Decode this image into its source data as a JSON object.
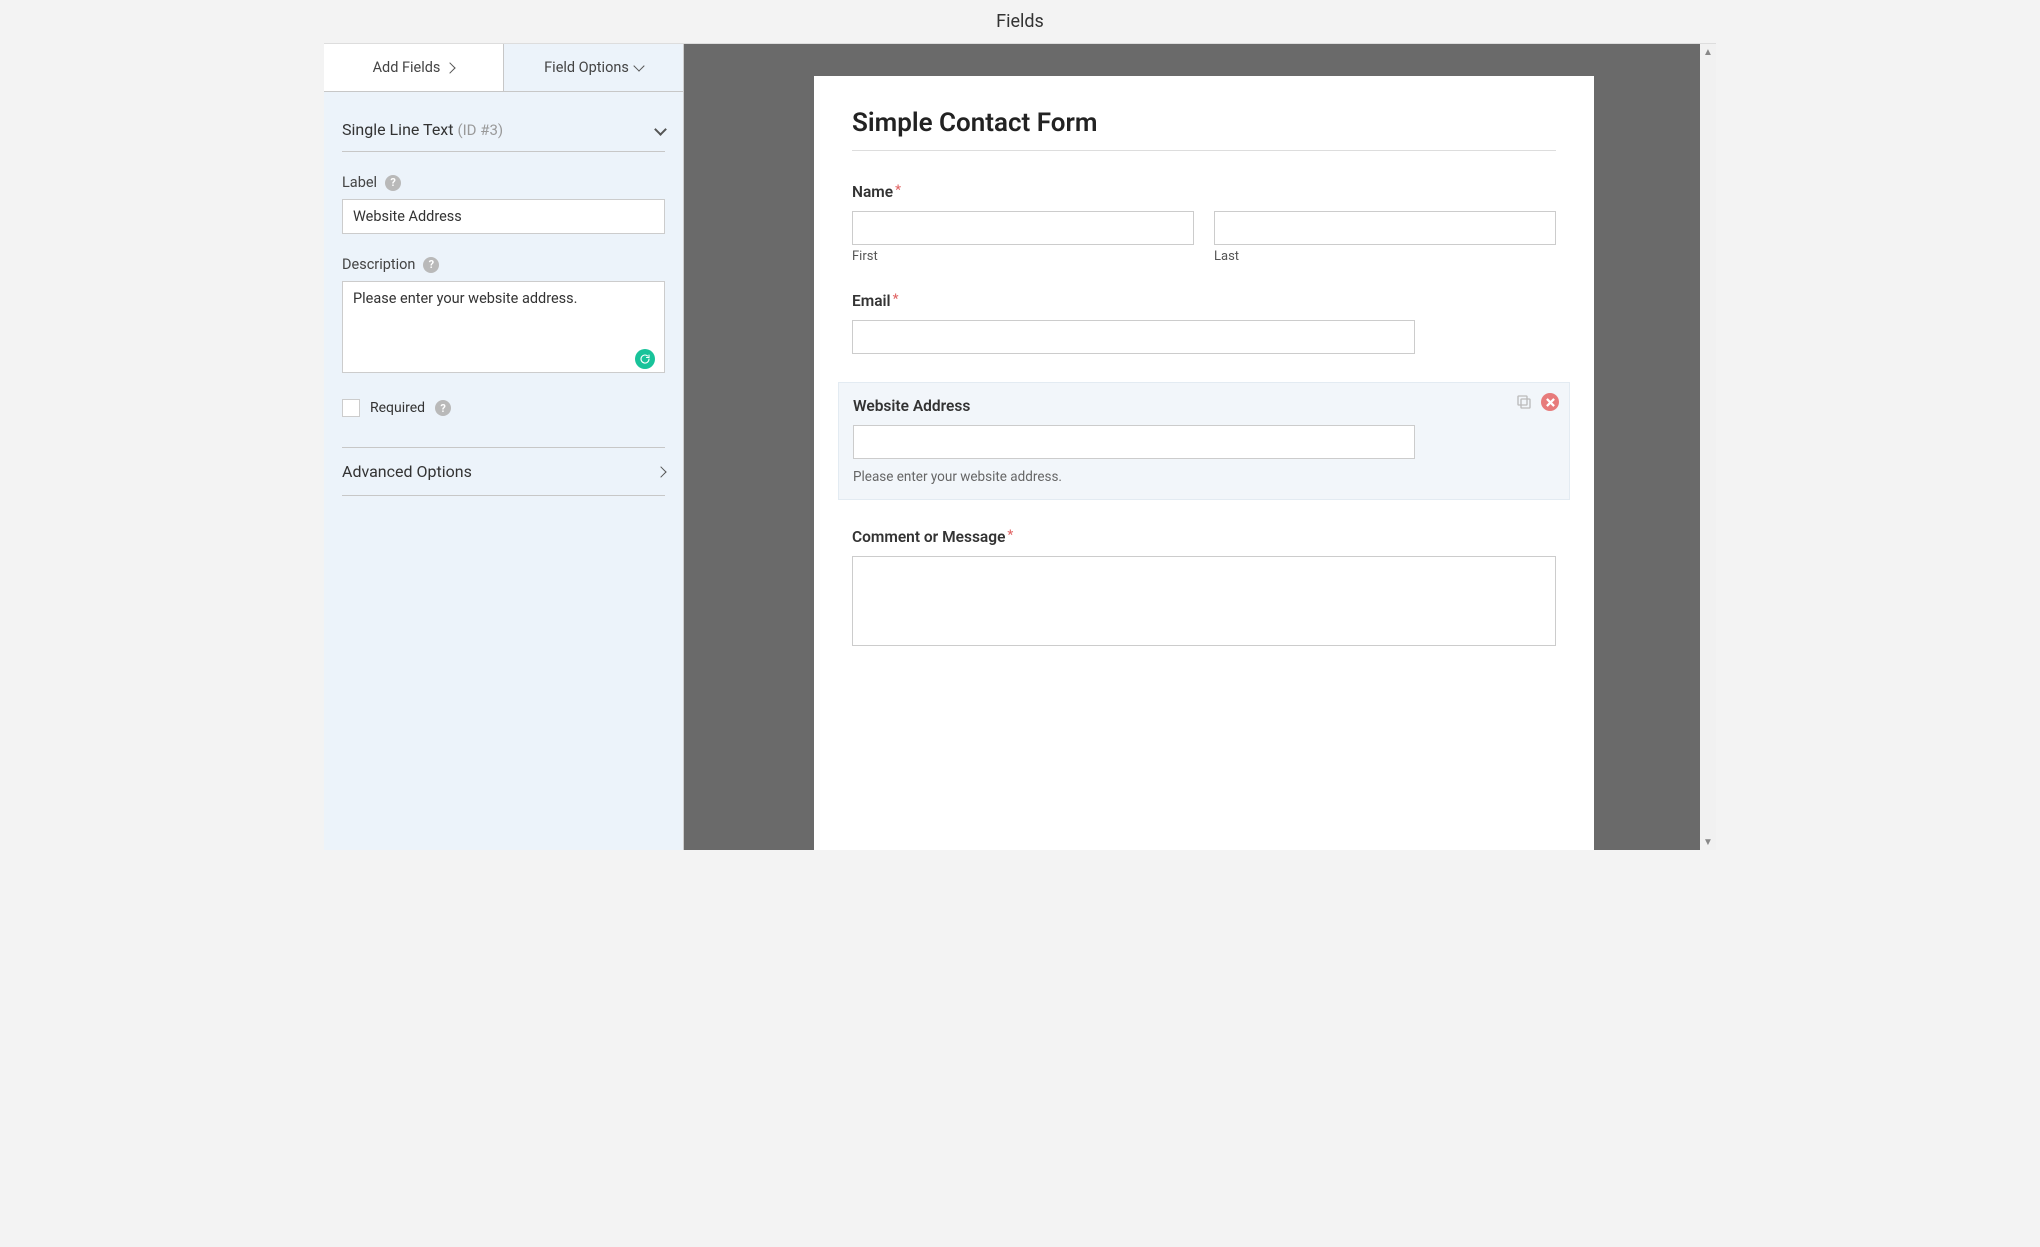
{
  "header": {
    "title": "Fields"
  },
  "tabs": {
    "add_fields": "Add Fields",
    "field_options": "Field Options"
  },
  "panel": {
    "type_label": "Single Line Text",
    "id_label": "(ID #3)",
    "label_label": "Label",
    "label_value": "Website Address",
    "description_label": "Description",
    "description_value": "Please enter your website address.",
    "required_label": "Required",
    "required_checked": false,
    "advanced_label": "Advanced Options"
  },
  "form": {
    "title": "Simple Contact Form",
    "fields": {
      "name": {
        "label": "Name",
        "required": true,
        "first_sub": "First",
        "last_sub": "Last"
      },
      "email": {
        "label": "Email",
        "required": true
      },
      "website": {
        "label": "Website Address",
        "required": false,
        "description": "Please enter your website address."
      },
      "message": {
        "label": "Comment or Message",
        "required": true
      }
    }
  }
}
